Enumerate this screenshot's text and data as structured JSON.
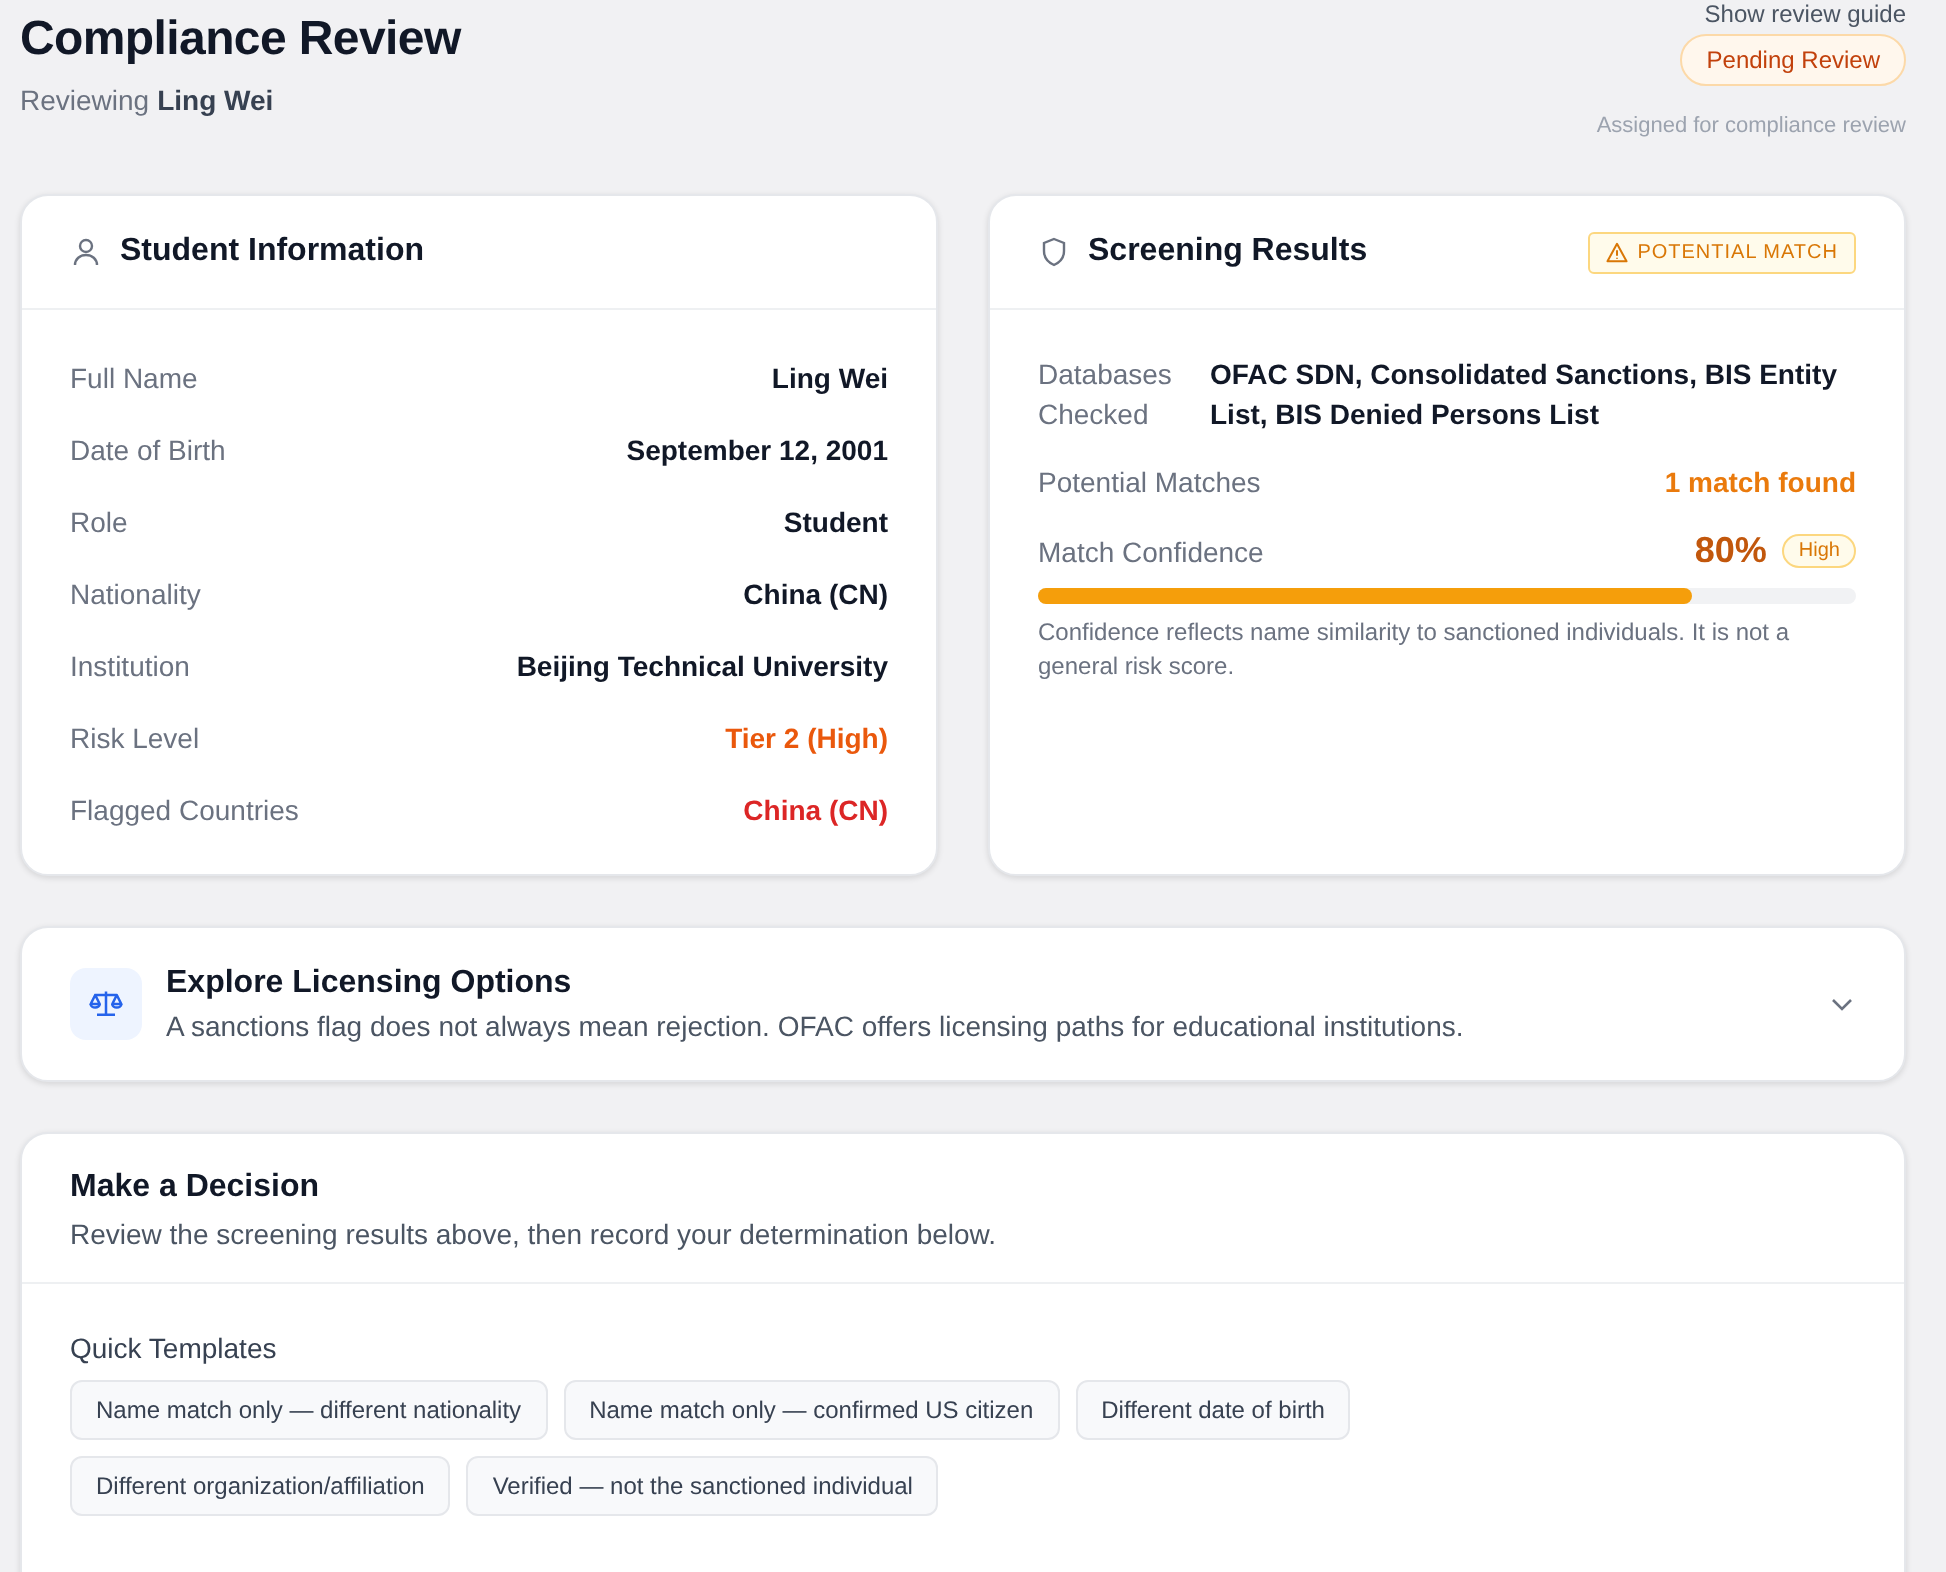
{
  "header": {
    "title": "Compliance Review",
    "subtitle_prefix": "Reviewing",
    "subject": "Ling Wei",
    "guide_link": "Show review guide",
    "status": "Pending Review",
    "status_note": "Assigned for compliance review"
  },
  "student": {
    "title": "Student Information",
    "fields": [
      {
        "label": "Full Name",
        "value": "Ling Wei",
        "color": "#111827"
      },
      {
        "label": "Date of Birth",
        "value": "September 12, 2001",
        "color": "#111827"
      },
      {
        "label": "Role",
        "value": "Student",
        "color": "#111827"
      },
      {
        "label": "Nationality",
        "value": "China (CN)",
        "color": "#111827"
      },
      {
        "label": "Institution",
        "value": "Beijing Technical University",
        "color": "#111827"
      },
      {
        "label": "Risk Level",
        "value": "Tier 2 (High)",
        "color": "#ea580c"
      },
      {
        "label": "Flagged Countries",
        "value": "China (CN)",
        "color": "#dc2626"
      }
    ]
  },
  "screening": {
    "title": "Screening Results",
    "badge": "POTENTIAL MATCH",
    "databases_label": "Databases Checked",
    "databases": "OFAC SDN, Consolidated Sanctions, BIS Entity List, BIS Denied Persons List",
    "matches_label": "Potential Matches",
    "matches": "1 match found",
    "confidence_label": "Match Confidence",
    "confidence": "80%",
    "confidence_tag": "High",
    "level": 0.8,
    "note": "Confidence reflects name similarity to sanctioned individuals. It is not a general risk score."
  },
  "licensing": {
    "title": "Explore Licensing Options",
    "text": "A sanctions flag does not always mean rejection. OFAC offers licensing paths for educational institutions.",
    "expanded": false
  },
  "decision": {
    "title": "Make a Decision",
    "subtitle": "Review the screening results above, then record your determination below.",
    "templates_label": "Quick Templates",
    "templates": [
      "Name match only — different nationality",
      "Name match only — confirmed US citizen",
      "Different date of birth",
      "Different organization/affiliation",
      "Verified — not the sanctioned individual"
    ]
  }
}
